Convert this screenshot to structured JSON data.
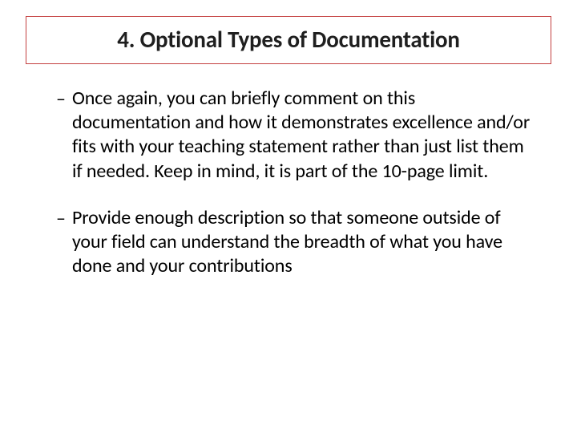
{
  "slide": {
    "title": "4. Optional Types of Documentation",
    "bullets": [
      {
        "text": "Once again, you can briefly comment on this documentation and how it demonstrates excellence and/or fits with your teaching statement rather than just list them if needed. Keep in mind, it is part of the 10-page limit."
      },
      {
        "text": "Provide enough description so that someone outside of your field can understand the breadth of what you have done and your contributions"
      }
    ]
  }
}
